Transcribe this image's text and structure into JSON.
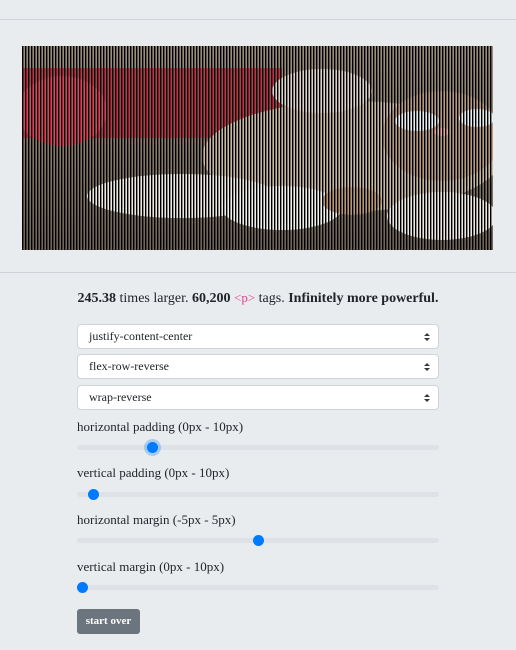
{
  "image_alt": "kitten photo rendered as vertical stripes",
  "caption": {
    "ratio": "245.38",
    "ratio_suffix": " times larger. ",
    "count": "60,200",
    "tag": "<p>",
    "tags_suffix": " tags. ",
    "tagline": "Infinitely more powerful."
  },
  "selects": [
    {
      "value": "justify-content-center"
    },
    {
      "value": "flex-row-reverse"
    },
    {
      "value": "wrap-reverse"
    }
  ],
  "sliders": [
    {
      "label": "horizontal padding (0px - 10px)",
      "min": 0,
      "max": 10,
      "value": 2
    },
    {
      "label": "vertical padding (0px - 10px)",
      "min": 0,
      "max": 10,
      "value": 0.3
    },
    {
      "label": "horizontal margin (-5px - 5px)",
      "min": -5,
      "max": 5,
      "value": 0
    },
    {
      "label": "vertical margin (0px - 10px)",
      "min": 0,
      "max": 10,
      "value": 0
    }
  ],
  "button": {
    "label": "start over"
  },
  "colors": {
    "accent": "#007bff",
    "button": "#6c757d",
    "tag": "#e83e8c"
  }
}
